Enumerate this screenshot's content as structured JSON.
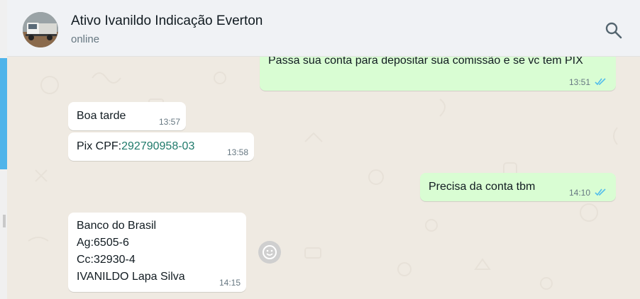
{
  "contact": {
    "name": "Ativo Ivanildo Indicação Everton",
    "status": "online",
    "avatar_icon": "truck-avatar-icon"
  },
  "header": {
    "search_icon": "search-icon"
  },
  "colors": {
    "chat_background": "#efeae2",
    "incoming_bubble": "#ffffff",
    "outgoing_bubble": "#d9fdd3",
    "read_ticks": "#53bdeb",
    "link": "#1f7a6b"
  },
  "messages": [
    {
      "direction": "out",
      "text": "Passa sua conta para depositar sua comissão e se vc tem PIX",
      "time": "13:51",
      "read": true
    },
    {
      "direction": "in",
      "text": "Boa tarde",
      "time": "13:57"
    },
    {
      "direction": "in",
      "prefix": "Pix CPF:",
      "link": "292790958-03",
      "time": "13:58"
    },
    {
      "direction": "out",
      "text": "Precisa da conta tbm",
      "time": "14:10",
      "read": true
    },
    {
      "direction": "in",
      "lines": [
        "Banco do Brasil",
        "Ag:6505-6",
        "Cc:32930-4",
        "IVANILDO Lapa Silva"
      ],
      "time": "14:15"
    }
  ],
  "emoji_icon": "emoji-icon"
}
